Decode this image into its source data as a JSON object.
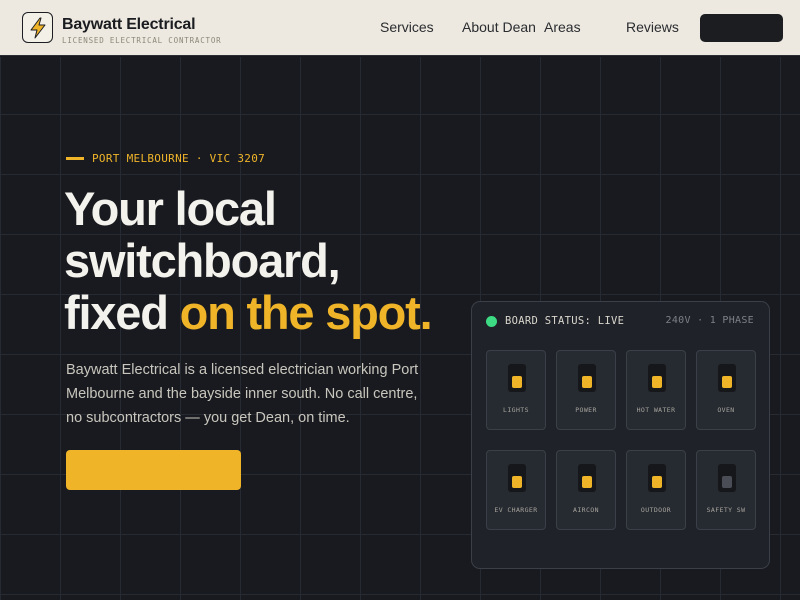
{
  "header": {
    "brand_name": "Baywatt Electrical",
    "brand_tagline": "LICENSED ELECTRICAL CONTRACTOR",
    "logo_icon": "lightning-bolt-icon",
    "nav": [
      {
        "label": "Services"
      },
      {
        "label": "About Dean"
      },
      {
        "label": "Areas"
      },
      {
        "label": "Reviews"
      }
    ],
    "cta_label": ""
  },
  "hero": {
    "eyebrow": "PORT MELBOURNE · VIC 3207",
    "headline_line1": "Your local",
    "headline_line2": "switchboard,",
    "headline_line3_plain": "fixed ",
    "headline_line3_accent": "on the spot.",
    "lede": "Baywatt Electrical is a licensed electrician working Port Melbourne and the bayside inner south. No call centre, no subcontractors — you get Dean, on time.",
    "cta_label": ""
  },
  "board": {
    "status_label": "BOARD STATUS: LIVE",
    "spec": "240V · 1 PHASE",
    "breakers": [
      {
        "label": "LIGHTS",
        "on": true
      },
      {
        "label": "POWER",
        "on": true
      },
      {
        "label": "HOT WATER",
        "on": true
      },
      {
        "label": "OVEN",
        "on": true
      },
      {
        "label": "EV CHARGER",
        "on": true
      },
      {
        "label": "AIRCON",
        "on": true
      },
      {
        "label": "OUTDOOR",
        "on": true
      },
      {
        "label": "SAFETY SW",
        "on": false
      }
    ]
  },
  "colors": {
    "accent": "#f0b429",
    "status_live": "#3ddc84",
    "background": "#181a1f",
    "header_bg": "#ede9e0"
  }
}
